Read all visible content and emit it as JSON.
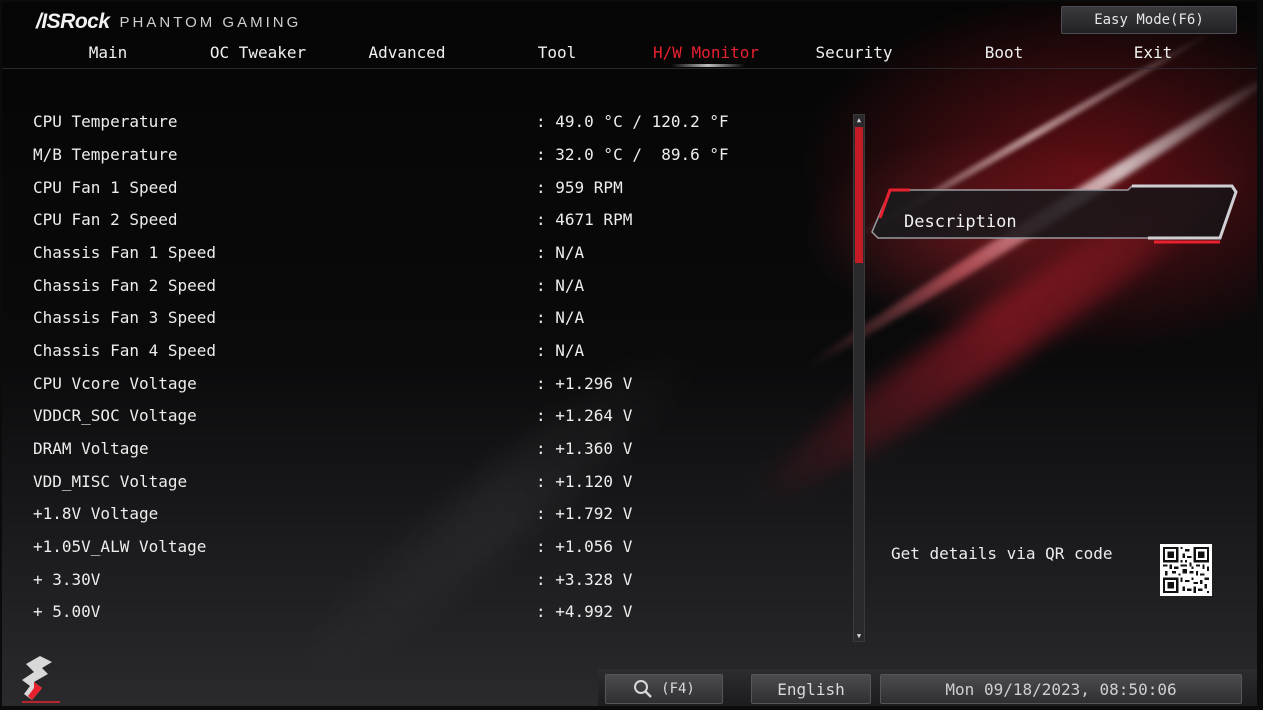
{
  "header": {
    "brand_name": "/ISRock",
    "brand_sub": "PHANTOM GAMING",
    "easy_mode_label": "Easy Mode(F6)"
  },
  "nav": {
    "tabs": [
      {
        "label": "Main"
      },
      {
        "label": "OC Tweaker"
      },
      {
        "label": "Advanced"
      },
      {
        "label": "Tool"
      },
      {
        "label": "H/W Monitor",
        "active": true
      },
      {
        "label": "Security"
      },
      {
        "label": "Boot"
      },
      {
        "label": "Exit"
      }
    ]
  },
  "monitor": {
    "rows": [
      {
        "label": "CPU Temperature",
        "value": ": 49.0 °C / 120.2 °F"
      },
      {
        "label": "M/B Temperature",
        "value": ": 32.0 °C /  89.6 °F"
      },
      {
        "label": "CPU Fan 1 Speed",
        "value": ": 959 RPM"
      },
      {
        "label": "CPU Fan 2 Speed",
        "value": ": 4671 RPM"
      },
      {
        "label": "Chassis Fan 1 Speed",
        "value": ": N/A"
      },
      {
        "label": "Chassis Fan 2 Speed",
        "value": ": N/A"
      },
      {
        "label": "Chassis Fan 3 Speed",
        "value": ": N/A"
      },
      {
        "label": "Chassis Fan 4 Speed",
        "value": ": N/A"
      },
      {
        "label": "CPU Vcore Voltage",
        "value": ": +1.296 V"
      },
      {
        "label": "VDDCR_SOC Voltage",
        "value": ": +1.264 V"
      },
      {
        "label": "DRAM Voltage",
        "value": ": +1.360 V"
      },
      {
        "label": "VDD_MISC Voltage",
        "value": ": +1.120 V"
      },
      {
        "label": "+1.8V Voltage",
        "value": ": +1.792 V"
      },
      {
        "label": "+1.05V_ALW Voltage",
        "value": ": +1.056 V"
      },
      {
        "label": "+ 3.30V",
        "value": ": +3.328 V"
      },
      {
        "label": "+ 5.00V",
        "value": ": +4.992 V"
      }
    ]
  },
  "description": {
    "title": "Description",
    "qr_text": "Get details via QR code"
  },
  "footer": {
    "search_key": "(F4)",
    "language": "English",
    "datetime": "Mon 09/18/2023, 08:50:06"
  },
  "colors": {
    "accent_red": "#e8212f",
    "scroll_thumb": "#c41b26"
  },
  "scrollbar": {
    "visible_fraction": 0.27
  }
}
